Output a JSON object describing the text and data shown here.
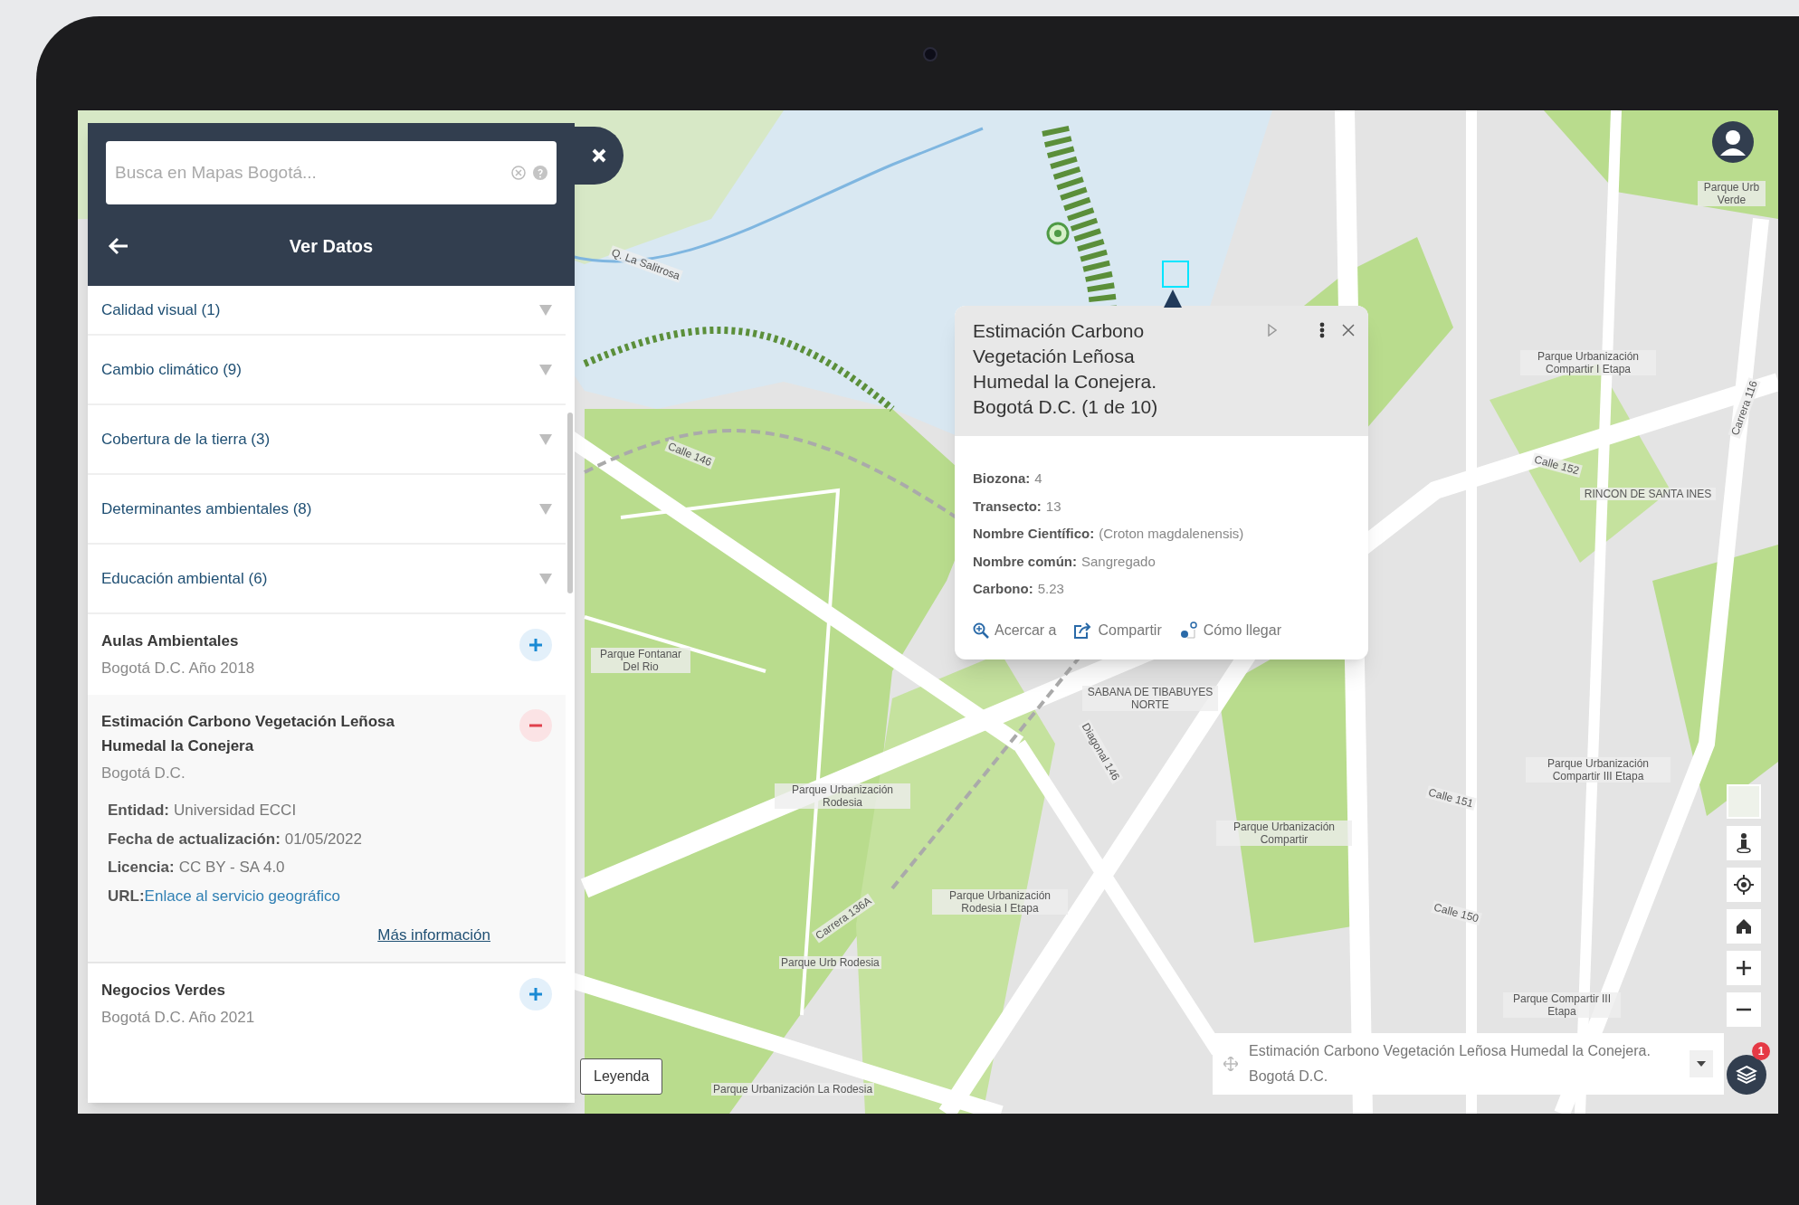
{
  "search": {
    "placeholder": "Busca en Mapas Bogotá..."
  },
  "panel": {
    "title": "Ver Datos"
  },
  "categories": [
    {
      "label": "Calidad visual (1)",
      "expanded": false
    },
    {
      "label": "Cambio climático (9)",
      "expanded": false
    },
    {
      "label": "Cobertura de la tierra (3)",
      "expanded": false
    },
    {
      "label": "Determinantes ambientales (8)",
      "expanded": false
    },
    {
      "label": "Educación ambiental (6)",
      "expanded": false
    }
  ],
  "layers": [
    {
      "title": "Aulas Ambientales",
      "subtitle": "Bogotá D.C. Año 2018",
      "added": false
    },
    {
      "title": "Estimación Carbono Vegetación Leñosa Humedal la Conejera",
      "subtitle": "Bogotá D.C.",
      "added": true,
      "details": [
        {
          "label": "Entidad:",
          "value": "Universidad ECCI"
        },
        {
          "label": "Fecha de actualización:",
          "value": "01/05/2022"
        },
        {
          "label": "Licencia:",
          "value": "CC BY - SA 4.0"
        },
        {
          "label": "URL:",
          "link": "Enlace al servicio geográfico"
        }
      ],
      "more_link": "Más información"
    },
    {
      "title": "Negocios Verdes",
      "subtitle": "Bogotá D.C. Año 2021",
      "added": false
    }
  ],
  "popup": {
    "title": "Estimación Carbono Vegetación Leñosa Humedal la Conejera. Bogotá D.C. (1 de 10)",
    "fields": [
      {
        "label": "Biozona:",
        "value": "4"
      },
      {
        "label": "Transecto:",
        "value": "13"
      },
      {
        "label": "Nombre Científico:",
        "value": "(Croton magdalenensis)"
      },
      {
        "label": "Nombre común:",
        "value": "Sangregado"
      },
      {
        "label": "Carbono:",
        "value": "5.23"
      }
    ],
    "actions": [
      {
        "kind": "zoom",
        "label": "Acercar a"
      },
      {
        "kind": "share",
        "label": "Compartir"
      },
      {
        "kind": "directions",
        "label": "Cómo llegar"
      }
    ]
  },
  "legend_button": "Leyenda",
  "active_layer": {
    "label": "Estimación Carbono Vegetación Leñosa Humedal la Conejera. Bogotá D.C."
  },
  "layers_badge": "1",
  "map_labels": [
    "Parque Urb Verde",
    "Q. La Salitrosa",
    "Parque Urbanización Compartir I Etapa",
    "Carrera 116",
    "Calle 146",
    "Calle 152",
    "RINCON DE SANTA INES",
    "Parque Fontanar Del Rio",
    "SABANA DE TIBABUYES NORTE",
    "Diagonal 146",
    "Parque Urbanización Compartir III Etapa",
    "Parque Urbanización Rodesia",
    "Calle 151",
    "Parque Urbanización Compartir",
    "Parque Urbanización Rodesia I Etapa",
    "Calle 150",
    "Carrera 136A",
    "Parque Urb Rodesia",
    "Parque Compartir III Etapa",
    "Parque Urbanización La Rodesia"
  ]
}
